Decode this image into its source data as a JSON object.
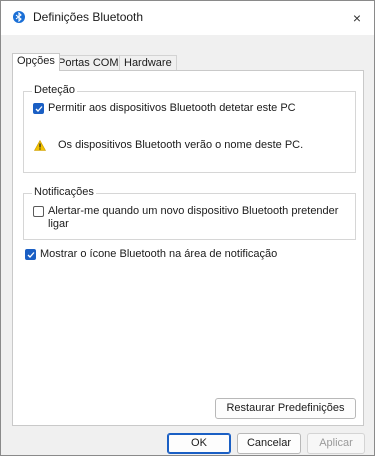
{
  "window": {
    "title": "Definições Bluetooth",
    "close_glyph": "×",
    "icon": "bluetooth-icon"
  },
  "tabs": [
    {
      "label": "Opções",
      "active": true
    },
    {
      "label": "Portas COM",
      "active": false
    },
    {
      "label": "Hardware",
      "active": false
    }
  ],
  "detection": {
    "group_label": "Deteção",
    "allow_discovery": {
      "label": "Permitir aos dispositivos Bluetooth detetar este PC",
      "checked": true
    },
    "warning_text": "Os dispositivos Bluetooth verão o nome deste PC.",
    "warning_icon": "warning-icon"
  },
  "notifications": {
    "group_label": "Notificações",
    "alert_new_device": {
      "label": "Alertar-me quando um novo dispositivo Bluetooth pretender ligar",
      "label_line1": "Alertar-me quando um novo dispositivo Bluetooth pretender",
      "label_line2": "ligar",
      "checked": false
    }
  },
  "show_icon": {
    "label": "Mostrar o ícone Bluetooth na área de notificação",
    "checked": true
  },
  "restore_button": "Restaurar Predefinições",
  "footer": {
    "ok": "OK",
    "cancel": "Cancelar",
    "apply": "Aplicar"
  },
  "colors": {
    "accent": "#1a5fc4",
    "warning": "#f2c200"
  }
}
